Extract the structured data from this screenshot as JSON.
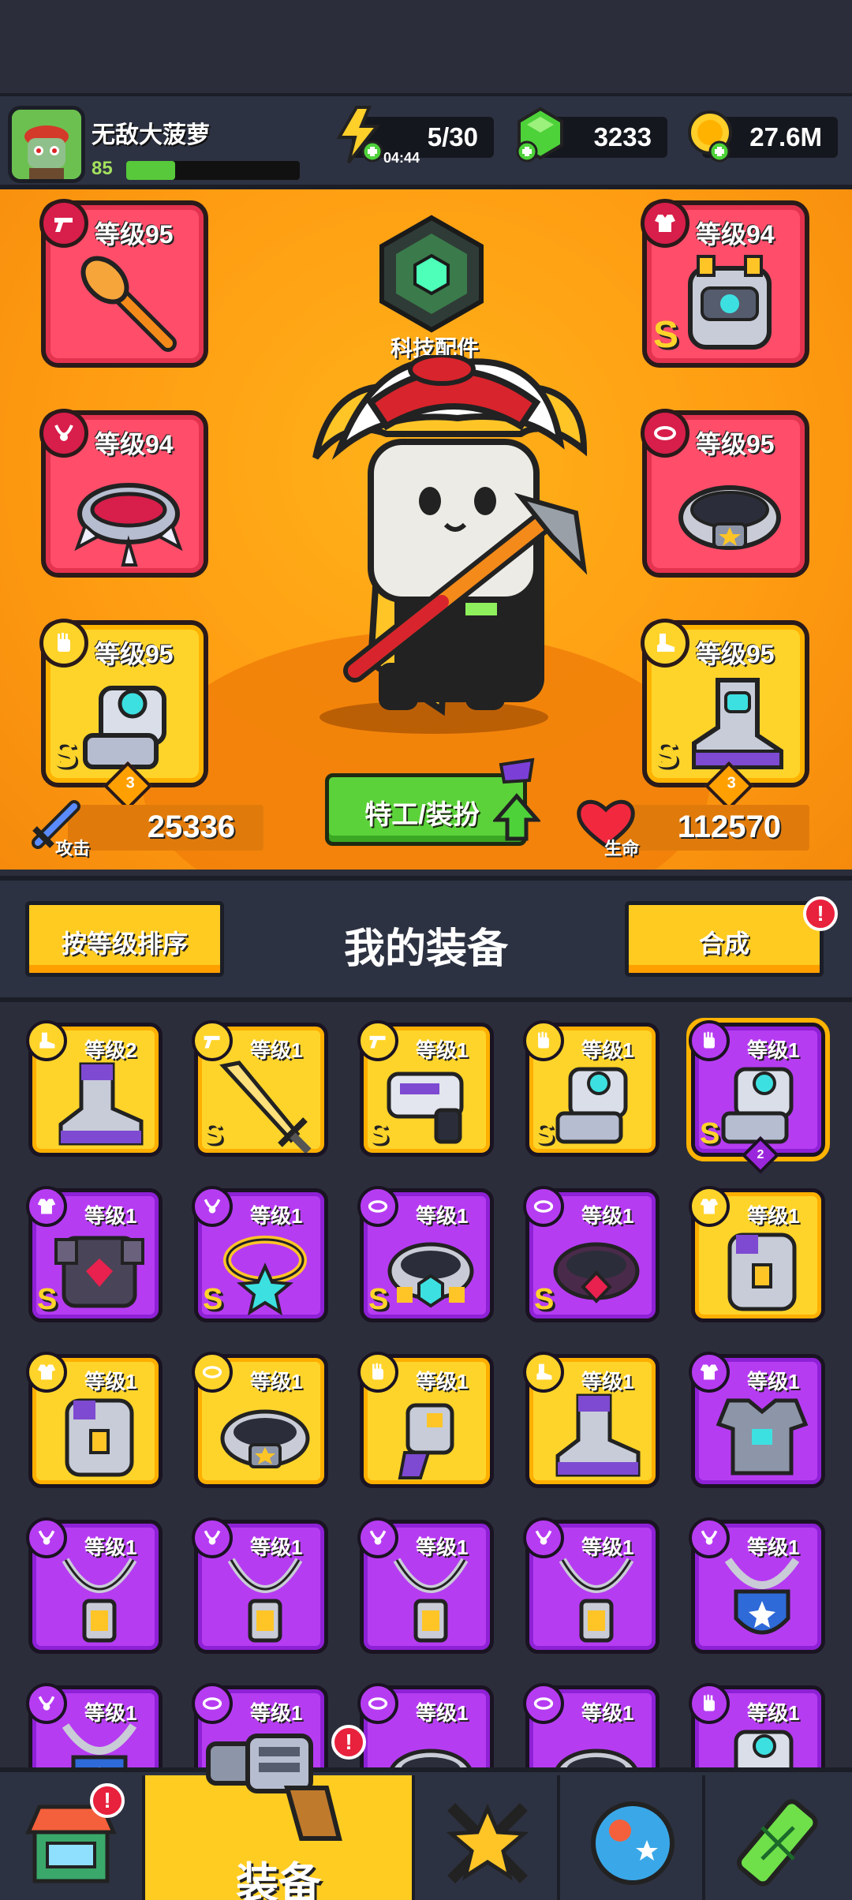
{
  "player": {
    "name": "无敌大菠萝",
    "level": "85",
    "xp_fraction": 0.28
  },
  "resources": {
    "energy": "5/30",
    "energy_timer": "04:44",
    "gems": "3233",
    "gold": "27.6M"
  },
  "hero": {
    "tech_label": "科技配件",
    "slots_left": [
      {
        "level": "等级95",
        "rarity": "red",
        "icon": "weapon-icon",
        "art": "torch-mace"
      },
      {
        "level": "等级94",
        "rarity": "red",
        "icon": "necklace-icon",
        "art": "spiked-collar"
      },
      {
        "level": "等级95",
        "rarity": "yellow",
        "icon": "glove-icon",
        "art": "robot-glove",
        "s": "S",
        "stars": "3"
      }
    ],
    "slots_right": [
      {
        "level": "等级94",
        "rarity": "red",
        "icon": "armor-icon",
        "art": "robot-chestplate",
        "s": "S"
      },
      {
        "level": "等级95",
        "rarity": "red",
        "icon": "belt-icon",
        "art": "star-belt"
      },
      {
        "level": "等级95",
        "rarity": "yellow",
        "icon": "boot-icon",
        "art": "robot-boot",
        "s": "S",
        "stars": "3"
      }
    ],
    "attack_label": "攻击",
    "attack_value": "25336",
    "hp_label": "生命",
    "hp_value": "112570",
    "agent_button": "特工/装扮"
  },
  "equipment": {
    "sort_button": "按等级排序",
    "title": "我的装备",
    "merge_button": "合成",
    "merge_alert": "!",
    "items": [
      {
        "level": "等级2",
        "rarity": "y",
        "icon": "boot-icon",
        "art": "boot"
      },
      {
        "level": "等级1",
        "rarity": "y",
        "icon": "weapon-icon",
        "art": "sword",
        "s": "S"
      },
      {
        "level": "等级1",
        "rarity": "y",
        "icon": "weapon-icon",
        "art": "blaster",
        "s": "S"
      },
      {
        "level": "等级1",
        "rarity": "y",
        "icon": "glove-icon",
        "art": "glove",
        "s": "S"
      },
      {
        "level": "等级1",
        "rarity": "p",
        "icon": "glove-icon",
        "art": "glove",
        "s": "S",
        "stars": "2",
        "selected": true
      },
      {
        "level": "等级1",
        "rarity": "p",
        "icon": "armor-icon",
        "art": "dark-armor",
        "s": "S"
      },
      {
        "level": "等级1",
        "rarity": "p",
        "icon": "necklace-icon",
        "art": "star-necklace",
        "s": "S"
      },
      {
        "level": "等级1",
        "rarity": "p",
        "icon": "belt-icon",
        "art": "gem-belt",
        "s": "S"
      },
      {
        "level": "等级1",
        "rarity": "p",
        "icon": "belt-icon",
        "art": "ruby-belt",
        "s": "S"
      },
      {
        "level": "等级1",
        "rarity": "y",
        "icon": "armor-icon",
        "art": "vest"
      },
      {
        "level": "等级1",
        "rarity": "y",
        "icon": "armor-icon",
        "art": "vest"
      },
      {
        "level": "等级1",
        "rarity": "y",
        "icon": "belt-icon",
        "art": "star-belt"
      },
      {
        "level": "等级1",
        "rarity": "y",
        "icon": "glove-icon",
        "art": "claw-glove"
      },
      {
        "level": "等级1",
        "rarity": "y",
        "icon": "boot-icon",
        "art": "boot"
      },
      {
        "level": "等级1",
        "rarity": "p",
        "icon": "armor-icon",
        "art": "plate-armor"
      },
      {
        "level": "等级1",
        "rarity": "p",
        "icon": "necklace-icon",
        "art": "chain-pendant"
      },
      {
        "level": "等级1",
        "rarity": "p",
        "icon": "necklace-icon",
        "art": "chain-pendant"
      },
      {
        "level": "等级1",
        "rarity": "p",
        "icon": "necklace-icon",
        "art": "chain-pendant"
      },
      {
        "level": "等级1",
        "rarity": "p",
        "icon": "necklace-icon",
        "art": "chain-pendant"
      },
      {
        "level": "等级1",
        "rarity": "p",
        "icon": "necklace-icon",
        "art": "shield-pendant"
      },
      {
        "level": "等级1",
        "rarity": "p",
        "icon": "necklace-icon",
        "art": "shield-pendant"
      },
      {
        "level": "等级1",
        "rarity": "p",
        "icon": "belt-icon",
        "art": "belt"
      },
      {
        "level": "等级1",
        "rarity": "p",
        "icon": "belt-icon",
        "art": "belt"
      },
      {
        "level": "等级1",
        "rarity": "p",
        "icon": "belt-icon",
        "art": "belt"
      },
      {
        "level": "等级1",
        "rarity": "p",
        "icon": "glove-icon",
        "art": "glove"
      }
    ]
  },
  "nav": {
    "tabs": [
      {
        "name": "shop",
        "label": "",
        "alert": "!"
      },
      {
        "name": "equipment",
        "label": "装备",
        "alert": "!",
        "active": true
      },
      {
        "name": "heroes",
        "label": ""
      },
      {
        "name": "world",
        "label": ""
      },
      {
        "name": "lab",
        "label": ""
      }
    ]
  },
  "colors": {
    "hero_bg": "#ff9d12",
    "slot_red": "#ff4d6a",
    "item_yellow": "#ffd42a",
    "item_purple": "#b63cf2",
    "button_green": "#5bd23a",
    "panel_dark": "#2d3242"
  }
}
